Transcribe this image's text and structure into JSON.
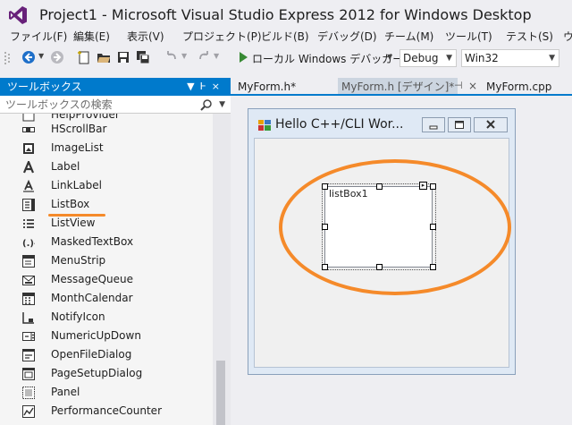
{
  "title": {
    "text": "Project1 - Microsoft Visual Studio Express 2012 for Windows Desktop"
  },
  "menu": [
    "ファイル(F)",
    "編集(E)",
    "表示(V)",
    "プロジェクト(P)",
    "ビルド(B)",
    "デバッグ(D)",
    "チーム(M)",
    "ツール(T)",
    "テスト(S)",
    "ウ"
  ],
  "toolbar": {
    "run_label": "ローカル Windows デバッガー",
    "config": "Debug",
    "platform": "Win32"
  },
  "toolbox": {
    "title": "ツールボックス",
    "search_placeholder": "ツールボックスの検索",
    "partial_item": "HelpProvider",
    "items": [
      {
        "label": "HScrollBar",
        "icon": "hscrollbar-icon"
      },
      {
        "label": "ImageList",
        "icon": "imagelist-icon"
      },
      {
        "label": "Label",
        "icon": "label-icon"
      },
      {
        "label": "LinkLabel",
        "icon": "linklabel-icon"
      },
      {
        "label": "ListBox",
        "icon": "listbox-icon"
      },
      {
        "label": "ListView",
        "icon": "listview-icon"
      },
      {
        "label": "MaskedTextBox",
        "icon": "maskedtextbox-icon"
      },
      {
        "label": "MenuStrip",
        "icon": "menustrip-icon"
      },
      {
        "label": "MessageQueue",
        "icon": "messagequeue-icon"
      },
      {
        "label": "MonthCalendar",
        "icon": "monthcalendar-icon"
      },
      {
        "label": "NotifyIcon",
        "icon": "notifyicon-icon"
      },
      {
        "label": "NumericUpDown",
        "icon": "numericupdown-icon"
      },
      {
        "label": "OpenFileDialog",
        "icon": "openfiledialog-icon"
      },
      {
        "label": "PageSetupDialog",
        "icon": "pagesetupdialog-icon"
      },
      {
        "label": "Panel",
        "icon": "panel-icon"
      },
      {
        "label": "PerformanceCounter",
        "icon": "performancecounter-icon"
      }
    ]
  },
  "tabs": [
    {
      "label": "MyForm.h*",
      "active": false
    },
    {
      "label": "MyForm.h [デザイン]*",
      "active": true
    },
    {
      "label": "MyForm.cpp",
      "active": false
    }
  ],
  "designer": {
    "form_title": "Hello C++/CLI Wor...",
    "listbox_text": "listBox1"
  },
  "colors": {
    "accent": "#007acc",
    "annotation": "#f58a2a"
  }
}
